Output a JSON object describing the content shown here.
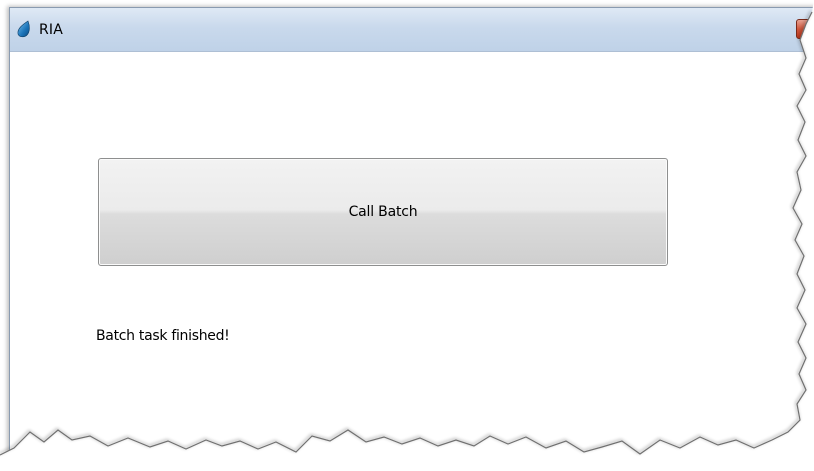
{
  "window": {
    "title": "RIA",
    "icon": "app-drop-icon",
    "close_icon": "close-icon"
  },
  "main": {
    "call_batch_label": "Call Batch",
    "status_text": "Batch task finished!"
  },
  "colors": {
    "titlebar": "#c9d9ec",
    "close_button": "#d0573d",
    "button_face": "#e6e6e6",
    "app_icon": "#1a73b8"
  }
}
